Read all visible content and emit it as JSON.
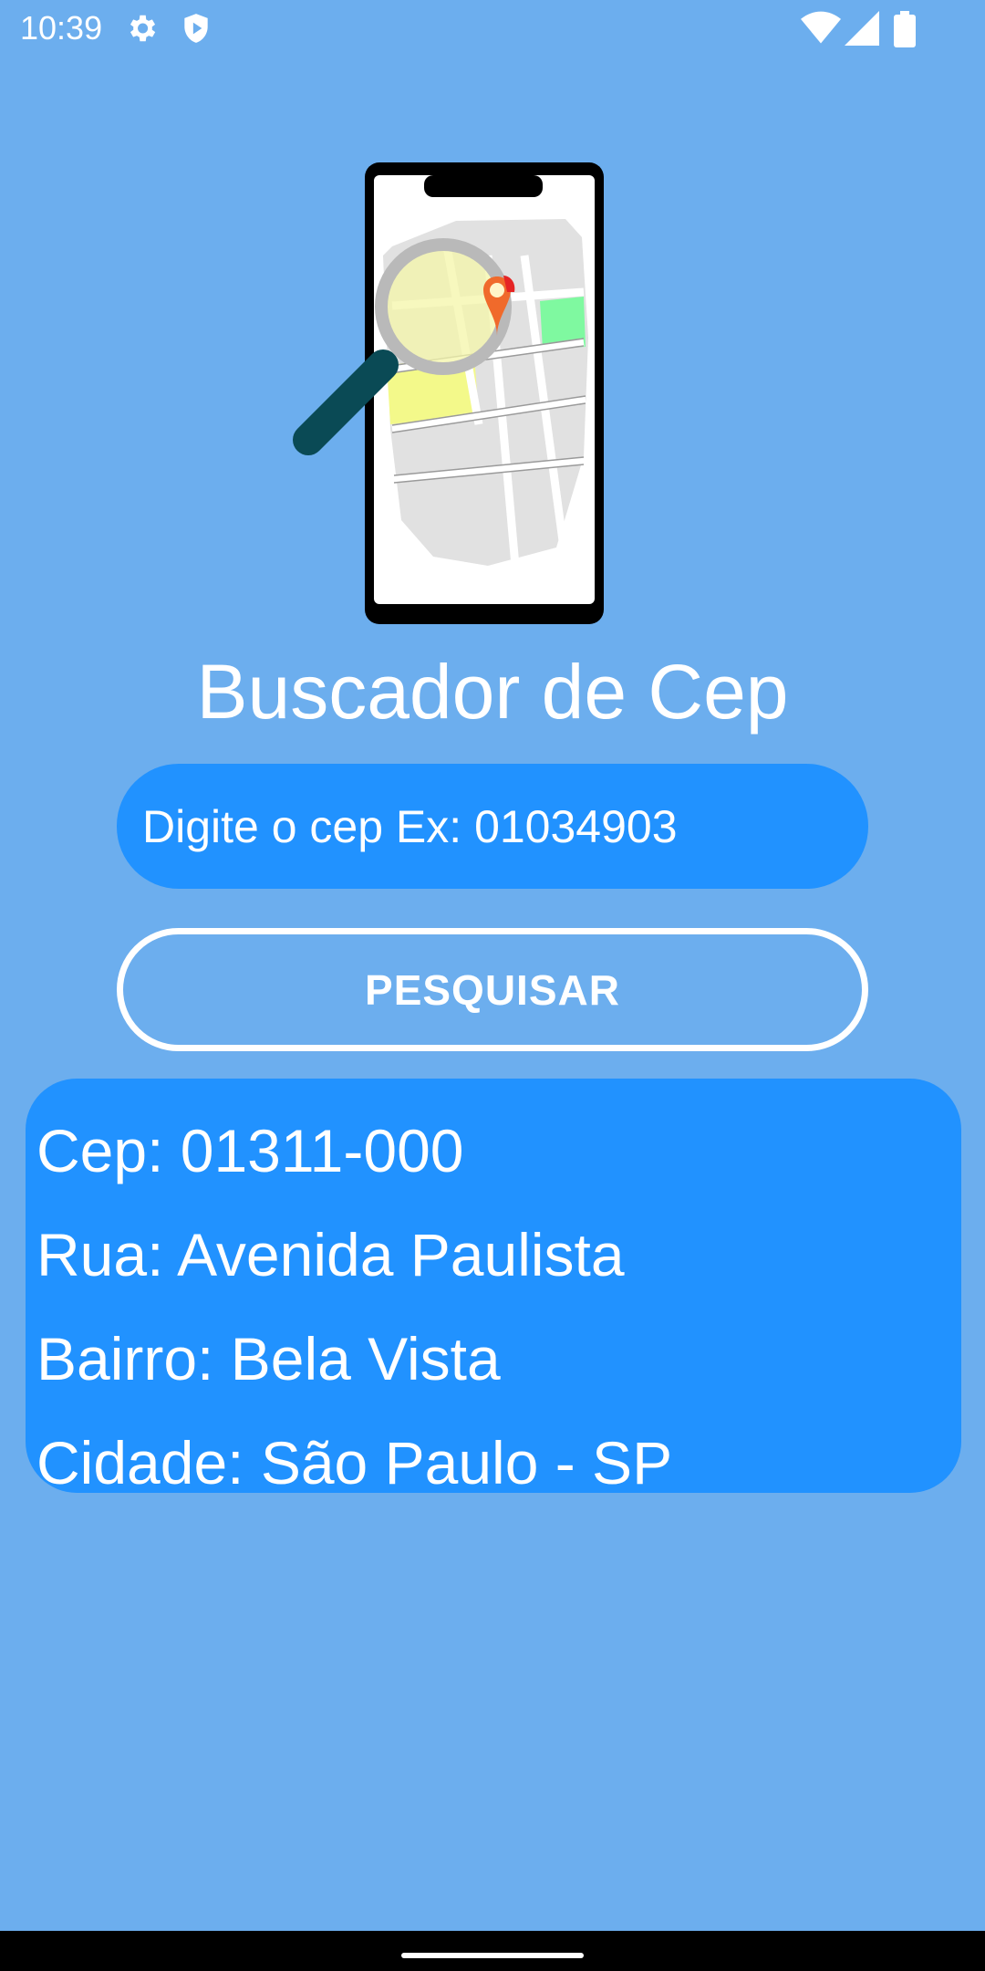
{
  "status_bar": {
    "time": "10:39",
    "icons_left": [
      "gear-icon",
      "shield-play-icon"
    ],
    "icons_right": [
      "wifi-icon",
      "signal-icon",
      "battery-icon"
    ]
  },
  "app": {
    "title": "Buscador de Cep"
  },
  "search": {
    "placeholder": "Digite o cep Ex: 01034903",
    "value": "",
    "button_label": "PESQUISAR"
  },
  "result": {
    "cep": "Cep: 01311-000",
    "rua": "Rua: Avenida Paulista",
    "bairro": "Bairro: Bela Vista",
    "cidade": "Cidade: São Paulo - SP"
  },
  "colors": {
    "background": "#6caeee",
    "accent": "#2192ff",
    "text": "#ffffff"
  }
}
